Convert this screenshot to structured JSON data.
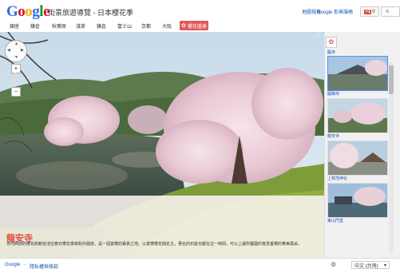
{
  "header": {
    "logo_text": "Google",
    "logo_colors": [
      "#3369e8",
      "#d50f25",
      "#eeb211",
      "#3369e8",
      "#009925",
      "#d50f25"
    ],
    "site_title": "街景旅遊導覽 - 日本櫻花季",
    "link_map": "地圖視角",
    "link_ext": "Google 街景服務",
    "gplus_label": "+1",
    "gplus_count": "0"
  },
  "nav": {
    "items": [
      "銀座",
      "鎌倉",
      "秋葉原",
      "淺草",
      "鎌倉",
      "富士山",
      "京都",
      "大阪"
    ],
    "sakura_label": "櫻花盛典"
  },
  "viewer": {
    "place_title": "龍安寺",
    "place_desc": "寺內西側的櫻花和鏡容池在春日櫻花季節對外開放，是一個賞櫻的寶貴之地。以賞櫻櫻花聞名主，著名的石庭也都在這一時間，可以上讓所屬園的寬見垂櫻的華美風采。"
  },
  "panel": {
    "thumbs": [
      {
        "label": "醍醐寺"
      },
      {
        "label": "龍安寺"
      },
      {
        "label": "上賀茂神社"
      },
      {
        "label": "東山門堂"
      }
    ],
    "top_label": "醍寺"
  },
  "footer": {
    "google": "Google",
    "separator": "-",
    "link": "隱私權與條款",
    "language": "中文 (台灣)"
  },
  "colors": {
    "accent": "#e05a57",
    "link": "#1a55b5",
    "title_red": "#e0503c"
  }
}
